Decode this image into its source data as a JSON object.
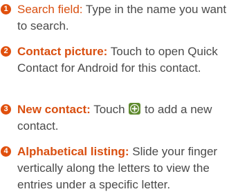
{
  "items": [
    {
      "number": "1",
      "term": "Search field",
      "separator": ":",
      "description": " Type in the name you want to search."
    },
    {
      "number": "2",
      "term": "Contact picture:",
      "description": " Touch to open Quick Contact for Android for this contact."
    },
    {
      "number": "3",
      "term": "New contact:",
      "description_before_icon": " Touch ",
      "icon": "add-contact-plus-icon",
      "description_after_icon": " to add a new contact."
    },
    {
      "number": "4",
      "term": "Alphabetical listing:",
      "description": " Slide your finger vertically along the letters to view the entries under a specific letter."
    }
  ],
  "colors": {
    "accent": "#d94f10",
    "badge": "#e0500d",
    "body_text": "#4a4a4a",
    "icon_fill": "#5f8a2e"
  }
}
